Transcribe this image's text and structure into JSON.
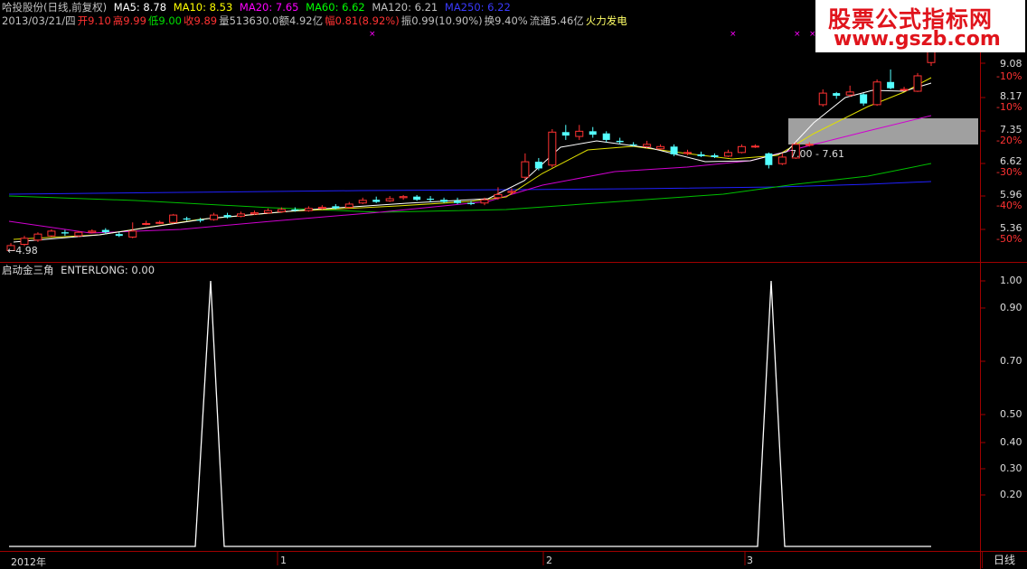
{
  "header": {
    "stock": "哈投股份(日线,前复权)",
    "ma5": "MA5: 8.78",
    "ma10": "MA10: 8.53",
    "ma20": "MA20: 7.65",
    "ma60": "MA60: 6.62",
    "ma120": "MA120: 6.21",
    "ma250": "MA250: 6.22",
    "date": "2013/03/21/四",
    "open_label": "开",
    "open": "9.10",
    "high_label": "高",
    "high": "9.99",
    "low_label": "低",
    "low": "9.00",
    "close_label": "收",
    "close": "9.89",
    "vol_label": "量",
    "vol": "513630.0",
    "amount_label": "额",
    "amount": "4.92亿",
    "chg_label": "幅",
    "chg": "0.81(8.92%)",
    "amp_label": "振",
    "amp": "0.99(10.90%)",
    "turn_label": "换",
    "turn": "9.40%",
    "float_label": "流通",
    "float": "5.46亿",
    "signal": "火力发电"
  },
  "watermark": {
    "line1": "股票公式指标网",
    "line2": "www.gszb.com"
  },
  "price_axis": {
    "labels": [
      "9.08",
      "-10%",
      "8.17",
      "-10%",
      "7.35",
      "-20%",
      "6.62",
      "-30%",
      "5.96",
      "-40%",
      "5.36",
      "-50%"
    ]
  },
  "price_panel": {
    "annotation": "7.00 - 7.61",
    "low_marker": "←4.98",
    "colors": {
      "up": "#ff3232",
      "down": "#54ffff",
      "ma5": "#ffffff",
      "ma10": "#ffff00",
      "ma20": "#ff00ff",
      "ma60": "#00ff00",
      "ma250": "#0000ff"
    }
  },
  "indicator": {
    "title": "启动金三角",
    "label": "ENTERLONG: 0.00",
    "axis": [
      "1.00",
      "0.90",
      "0.70",
      "0.50",
      "0.40",
      "0.30",
      "0.20"
    ]
  },
  "time_axis": {
    "year": "2012年",
    "m1": "1",
    "m2": "2",
    "m3": "3"
  },
  "tab_label": "日线",
  "chart_data": {
    "type": "line",
    "title": "启动金三角",
    "series": [
      {
        "name": "ENTERLONG",
        "values": [
          0,
          0,
          1,
          0,
          0,
          0,
          0,
          0,
          0,
          0,
          1,
          0,
          0
        ]
      }
    ],
    "ylim": [
      0,
      1.05
    ]
  }
}
